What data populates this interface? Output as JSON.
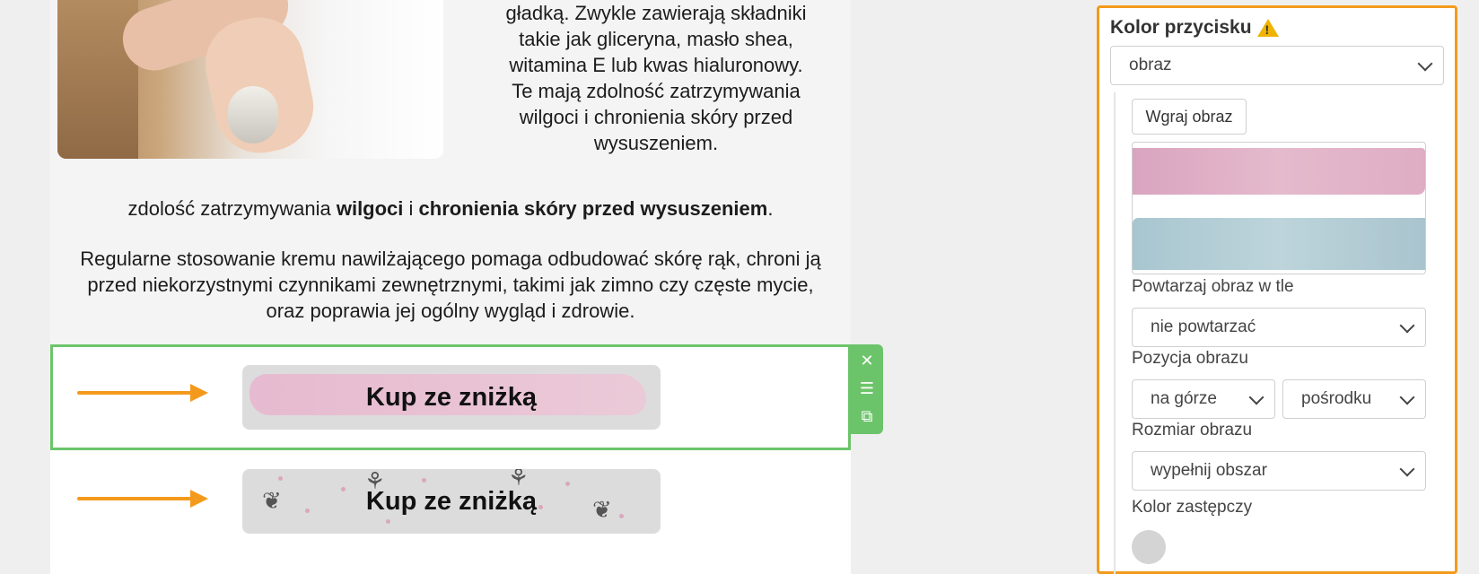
{
  "canvas": {
    "side_text_lines": [
      "gładką. Zwykle zawierają składniki",
      "takie jak gliceryna, masło shea,",
      "witamina E lub kwas hialuronowy.",
      "Te mają zdolność zatrzymywania",
      "wilgoci i chronienia skóry przed",
      "wysuszeniem."
    ],
    "mid_line": {
      "part1": "zdolość zatrzymywania ",
      "bold1": "wilgoci",
      "part2": " i ",
      "bold2": "chronienia skóry przed wysuszeniem",
      "part3": "."
    },
    "paragraph": "Regularne stosowanie kremu nawilżającego pomaga odbudować skórę rąk, chroni ją przed niekorzystnymi czynnikami zewnętrznymi, takimi jak zimno czy częste mycie, oraz poprawia jej ogólny wygląd i zdrowie.",
    "buttons": [
      {
        "label": "Kup ze zniżką"
      },
      {
        "label": "Kup ze zniżką"
      }
    ],
    "tools": {
      "close": "✕",
      "move": "☰",
      "copy": "⧉"
    },
    "arrow_color": "#f39a1c",
    "selection_color": "#6cc46a"
  },
  "panel": {
    "title": "Kolor przycisku",
    "warning_icon": "warning-icon",
    "fill_type": "obraz",
    "upload_label": "Wgraj obraz",
    "repeat_label": "Powtarzaj obraz w tle",
    "repeat_value": "nie powtarzać",
    "position_label": "Pozycja obrazu",
    "position_vertical": "na górze",
    "position_horizontal": "pośrodku",
    "size_label": "Rozmiar obrazu",
    "size_value": "wypełnij obszar",
    "fallback_label": "Kolor zastępczy",
    "fallback_color": "#d4d4d4",
    "border_color": "#f39a1c"
  }
}
